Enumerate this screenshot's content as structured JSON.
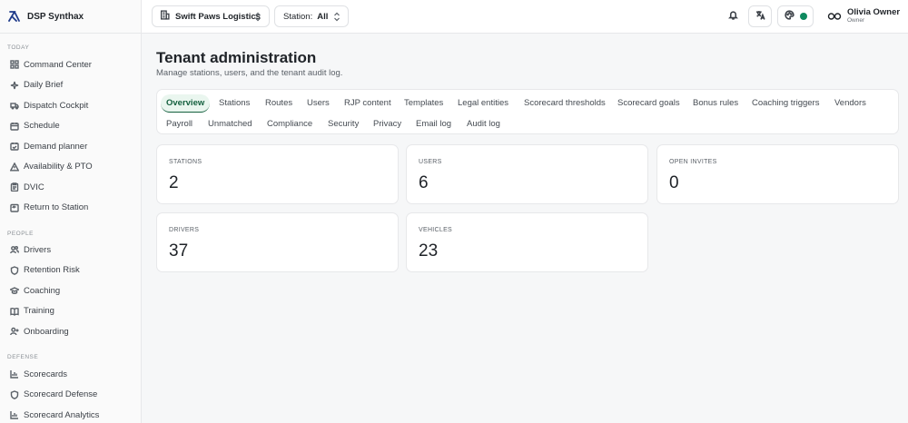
{
  "app": {
    "name": "DSP Synthax"
  },
  "sidebar": {
    "sections": [
      {
        "title": "TODAY",
        "items": [
          {
            "label": "Command Center",
            "icon": "grid-icon"
          },
          {
            "label": "Daily Brief",
            "icon": "sparkle-icon"
          },
          {
            "label": "Dispatch Cockpit",
            "icon": "truck-icon"
          },
          {
            "label": "Schedule",
            "icon": "calendar-icon"
          },
          {
            "label": "Demand planner",
            "icon": "calendar-check-icon"
          },
          {
            "label": "Availability & PTO",
            "icon": "warning-icon"
          },
          {
            "label": "DVIC",
            "icon": "clipboard-icon"
          },
          {
            "label": "Return to Station",
            "icon": "return-icon"
          }
        ]
      },
      {
        "title": "PEOPLE",
        "items": [
          {
            "label": "Drivers",
            "icon": "users-icon"
          },
          {
            "label": "Retention Risk",
            "icon": "shield-icon"
          },
          {
            "label": "Coaching",
            "icon": "graduation-cap-icon"
          },
          {
            "label": "Training",
            "icon": "book-icon"
          },
          {
            "label": "Onboarding",
            "icon": "user-plus-icon"
          }
        ]
      },
      {
        "title": "DEFENSE",
        "items": [
          {
            "label": "Scorecards",
            "icon": "bar-chart-icon"
          },
          {
            "label": "Scorecard Defense",
            "icon": "shield-icon"
          },
          {
            "label": "Scorecard Analytics",
            "icon": "bar-chart-icon"
          }
        ]
      }
    ]
  },
  "topbar": {
    "tenant": "Swift Paws Logistics",
    "station_label": "Station:",
    "station_value": "All",
    "user_name": "Olivia Owner",
    "user_role": "Owner",
    "status_color": "#0f8a5f"
  },
  "page": {
    "title": "Tenant administration",
    "subtitle": "Manage stations, users, and the tenant audit log."
  },
  "tabs": [
    "Overview",
    "Stations",
    "Routes",
    "Users",
    "RJP content",
    "Templates",
    "Legal entities",
    "Scorecard thresholds",
    "Scorecard goals",
    "Bonus rules",
    "Coaching triggers",
    "Vendors",
    "Payroll",
    "Unmatched",
    "Compliance",
    "Security",
    "Privacy",
    "Email log",
    "Audit log"
  ],
  "active_tab": "Overview",
  "stats": [
    {
      "label": "STATIONS",
      "value": "2"
    },
    {
      "label": "USERS",
      "value": "6"
    },
    {
      "label": "OPEN INVITES",
      "value": "0"
    },
    {
      "label": "DRIVERS",
      "value": "37"
    },
    {
      "label": "VEHICLES",
      "value": "23"
    }
  ],
  "colors": {
    "accent": "#15603f",
    "accent_bg": "#eaf6ef"
  }
}
